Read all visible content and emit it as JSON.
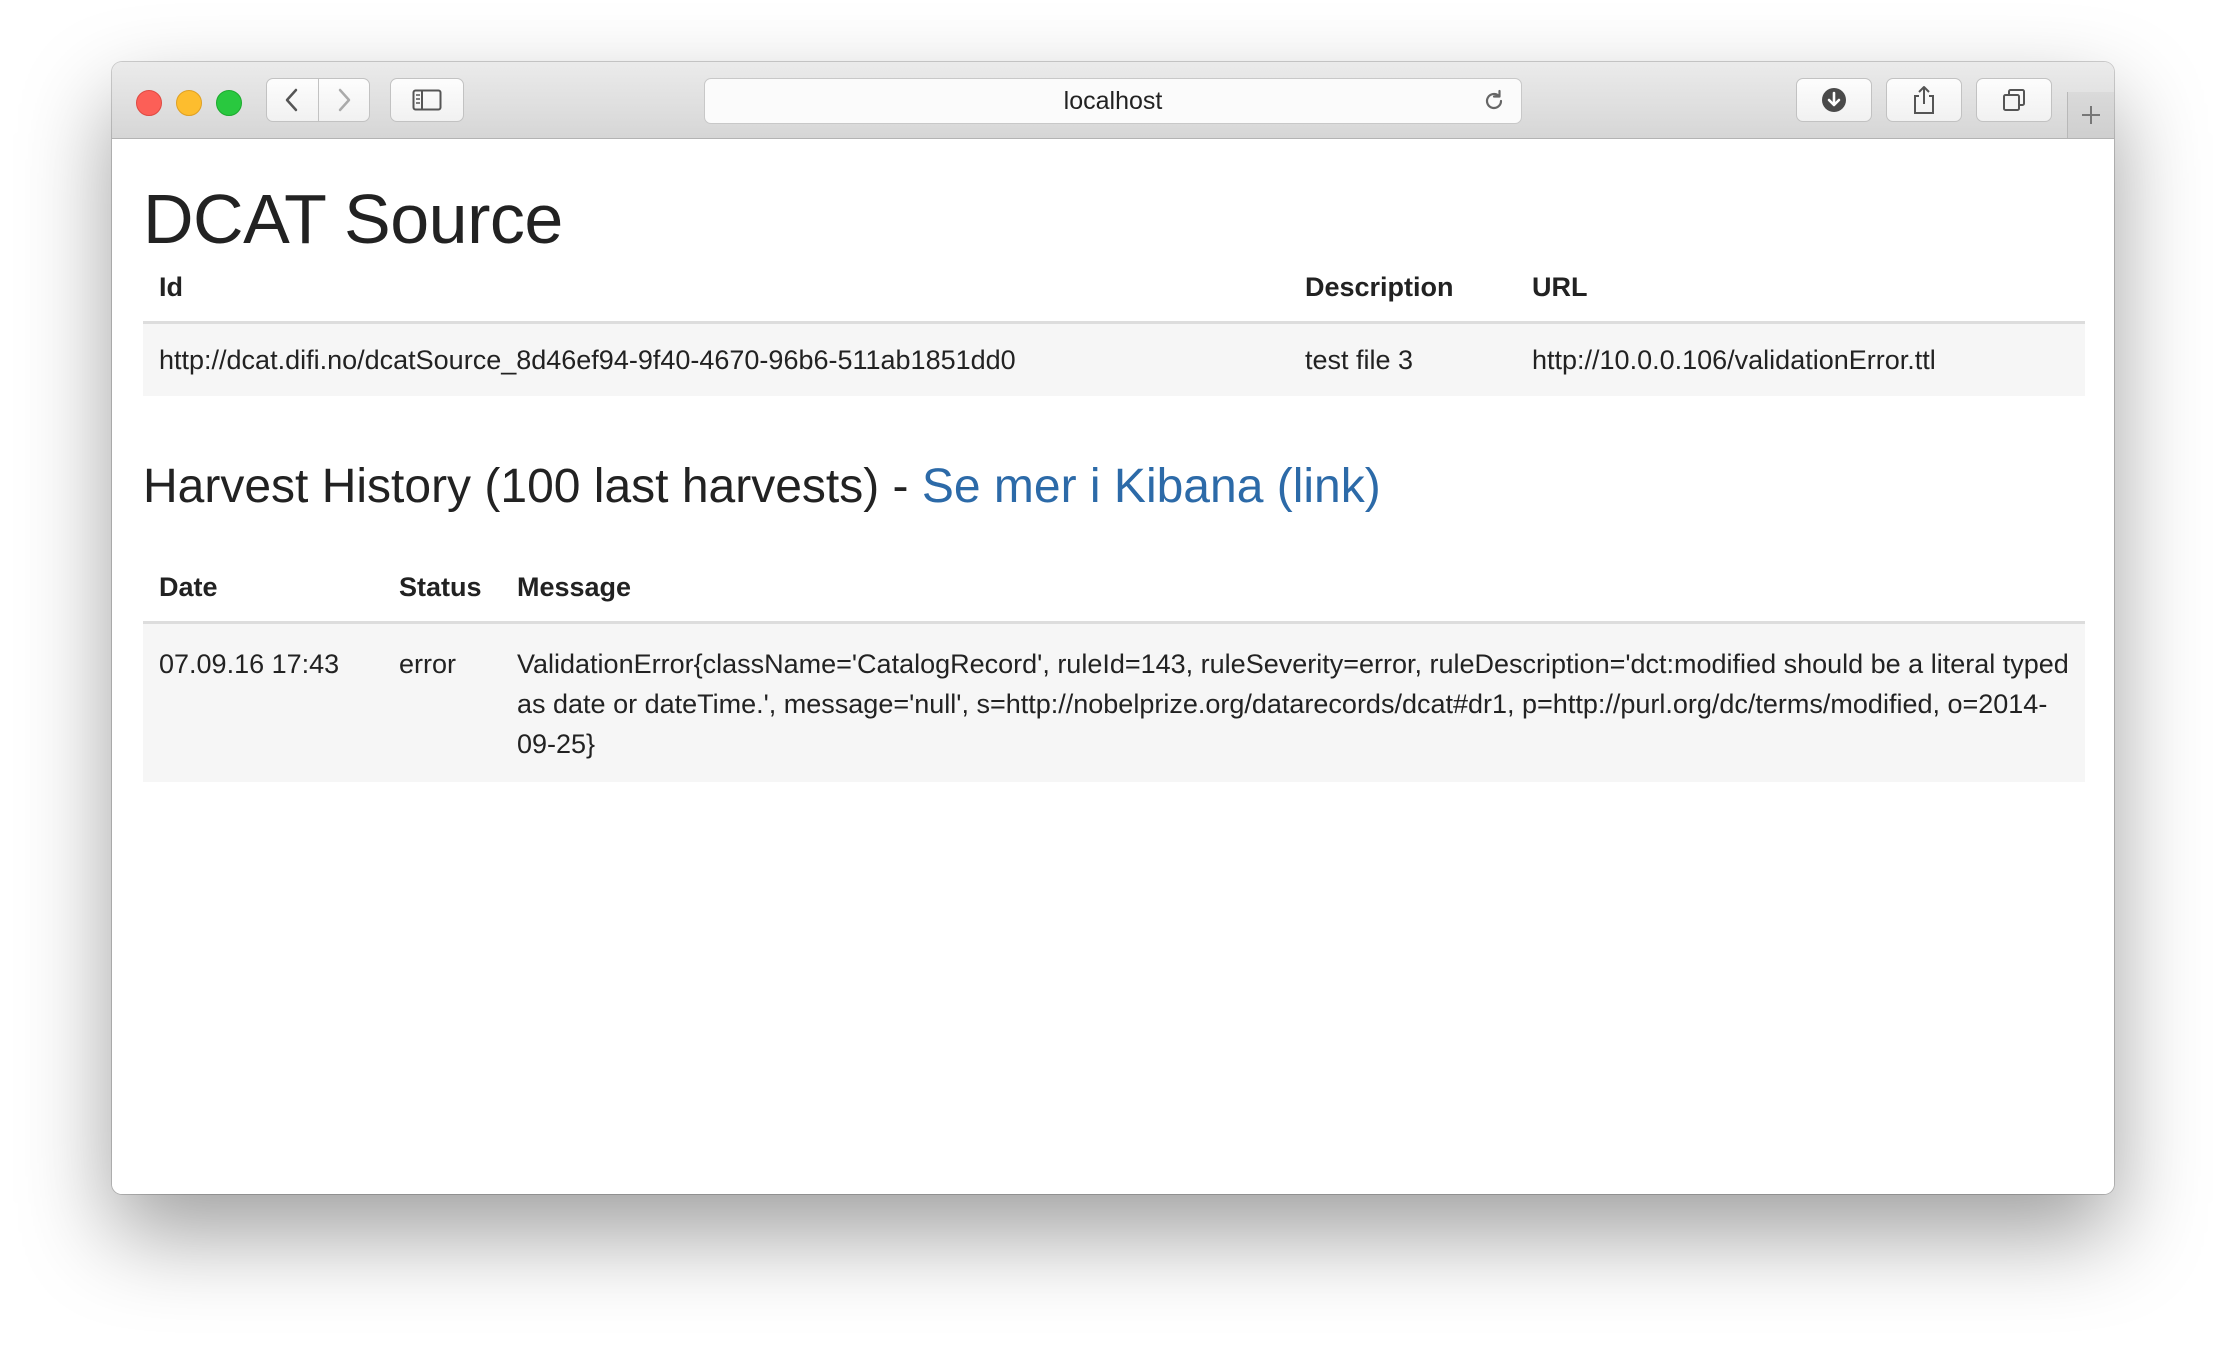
{
  "browser": {
    "url": "localhost"
  },
  "page": {
    "title": "DCAT Source"
  },
  "source_table": {
    "headers": [
      "Id",
      "Description",
      "URL"
    ],
    "rows": [
      {
        "id": "http://dcat.difi.no/dcatSource_8d46ef94-9f40-4670-96b6-511ab1851dd0",
        "description": "test file 3",
        "url": "http://10.0.0.106/validationError.ttl"
      }
    ]
  },
  "history": {
    "title": "Harvest History (100 last harvests) - ",
    "link_label": "Se mer i Kibana (link)",
    "headers": [
      "Date",
      "Status",
      "Message"
    ],
    "rows": [
      {
        "date": "07.09.16 17:43",
        "status": "error",
        "message": "ValidationError{className='CatalogRecord', ruleId=143, ruleSeverity=error, ruleDescription='dct:modified should be a literal typed as date or dateTime.', message='null', s=http://nobelprize.org/datarecords/dcat#dr1, p=http://purl.org/dc/terms/modified, o=2014-09-25}"
      }
    ]
  },
  "colors": {
    "link": "#2c6aa8",
    "close": "#fc5f57",
    "minimize": "#fdbd2e",
    "maximize": "#29c83f"
  }
}
